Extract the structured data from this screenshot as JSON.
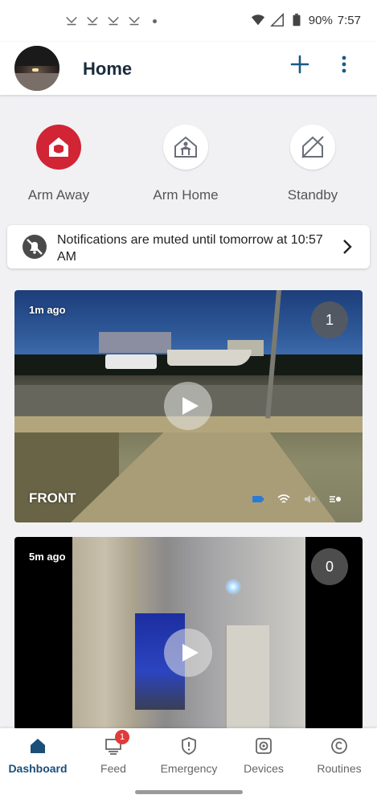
{
  "status_bar": {
    "battery": "90%",
    "time": "7:57"
  },
  "header": {
    "title": "Home"
  },
  "modes": [
    {
      "label": "Arm Away",
      "active": true,
      "icon": "arm-away-house-icon"
    },
    {
      "label": "Arm Home",
      "active": false,
      "icon": "arm-home-person-house-icon"
    },
    {
      "label": "Standby",
      "active": false,
      "icon": "standby-house-off-icon"
    }
  ],
  "notification": {
    "text": "Notifications are muted until tomorrow at 10:57 AM"
  },
  "cameras": [
    {
      "ago": "1m ago",
      "count": "1",
      "name": "FRONT"
    },
    {
      "ago": "5m ago",
      "count": "0",
      "name": ""
    }
  ],
  "nav": {
    "items": [
      {
        "label": "Dashboard",
        "icon": "house-icon",
        "active": true
      },
      {
        "label": "Feed",
        "icon": "feed-icon",
        "badge": "1"
      },
      {
        "label": "Emergency",
        "icon": "shield-alert-icon"
      },
      {
        "label": "Devices",
        "icon": "camera-device-icon"
      },
      {
        "label": "Routines",
        "icon": "routine-icon"
      }
    ]
  },
  "colors": {
    "accent_red": "#d12434",
    "nav_active": "#1a4f7a",
    "header_text": "#1a2b3c"
  }
}
